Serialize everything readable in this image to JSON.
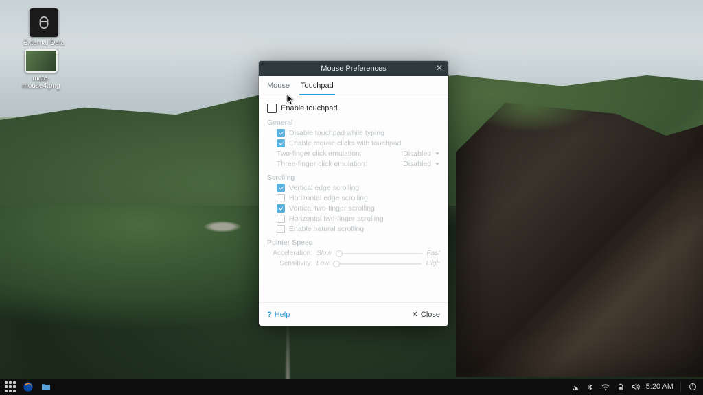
{
  "desktop": {
    "icons": [
      {
        "name": "external-data-icon",
        "label": "External Data"
      },
      {
        "name": "mate-mouse-png-icon",
        "label": "mate-mouse4.png"
      }
    ]
  },
  "window": {
    "title": "Mouse Preferences",
    "tabs": [
      {
        "label": "Mouse",
        "active": false
      },
      {
        "label": "Touchpad",
        "active": true
      }
    ],
    "enable": {
      "label": "Enable touchpad",
      "checked": false
    },
    "sections": {
      "general": {
        "title": "General",
        "check_typing": {
          "label": "Disable touchpad while typing",
          "checked": true
        },
        "check_clicks": {
          "label": "Enable mouse clicks with touchpad",
          "checked": true
        },
        "two_finger": {
          "label": "Two-finger click emulation:",
          "value": "Disabled"
        },
        "three_finger": {
          "label": "Three-finger click emulation:",
          "value": "Disabled"
        }
      },
      "scrolling": {
        "title": "Scrolling",
        "items": [
          {
            "label": "Vertical edge scrolling",
            "checked": true
          },
          {
            "label": "Horizontal edge scrolling",
            "checked": false
          },
          {
            "label": "Vertical two-finger scrolling",
            "checked": true
          },
          {
            "label": "Horizontal two-finger scrolling",
            "checked": false
          },
          {
            "label": "Enable natural scrolling",
            "checked": false
          }
        ]
      },
      "pointer": {
        "title": "Pointer Speed",
        "accel": {
          "label": "Acceleration:",
          "min": "Slow",
          "max": "Fast"
        },
        "sens": {
          "label": "Sensitivity:",
          "min": "Low",
          "max": "High"
        }
      }
    },
    "footer": {
      "help": "Help",
      "close": "Close"
    }
  },
  "taskbar": {
    "clock": "5:20 AM"
  }
}
